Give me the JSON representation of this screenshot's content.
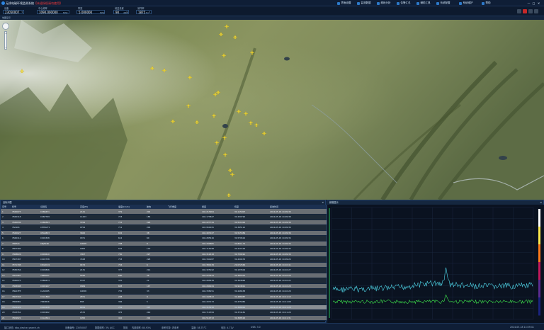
{
  "app": {
    "title": "无线电磁环境监测系统",
    "title_warn": "【未经授权请勿使用】",
    "menu": [
      {
        "label": "界面设置",
        "icon": "layout-icon"
      },
      {
        "label": "监测数据",
        "icon": "data-icon"
      },
      {
        "label": "频段分析",
        "icon": "analysis-icon"
      },
      {
        "label": "告警汇总",
        "icon": "alarm-icon"
      },
      {
        "label": "辅助工具",
        "icon": "tool-icon"
      },
      {
        "label": "系统配置",
        "icon": "config-icon"
      },
      {
        "label": "系统维护",
        "icon": "maintain-icon"
      },
      {
        "label": "帮助",
        "icon": "help-icon"
      }
    ],
    "window_controls": [
      "—",
      "□",
      "✕"
    ]
  },
  "params": [
    {
      "label": "设备",
      "value": "23050007",
      "unit": "",
      "dropdown": true
    },
    {
      "label": "中心频率",
      "value": "1090.000000",
      "unit": "MHz",
      "dropdown": false
    },
    {
      "label": "带宽",
      "value": "5.000000",
      "unit": "MHz",
      "dropdown": false
    },
    {
      "label": "增益设置",
      "value": "90",
      "unit": "dBm",
      "dropdown": true
    },
    {
      "label": "采样率",
      "value": "1875",
      "unit": "Hz",
      "dropdown": true
    }
  ],
  "toolbar_colors": [
    "#3a4a5e",
    "#c62828",
    "#3a4a5e",
    "#3a4a5e"
  ],
  "map": {
    "header": "地图显示",
    "zoom_in": "+",
    "zoom_out": "−",
    "aircraft": [
      [
        320,
        37
      ],
      [
        312,
        48
      ],
      [
        332,
        52
      ],
      [
        316,
        78
      ],
      [
        356,
        74
      ],
      [
        215,
        96
      ],
      [
        232,
        99
      ],
      [
        268,
        109
      ],
      [
        308,
        130
      ],
      [
        304,
        133
      ],
      [
        266,
        149
      ],
      [
        337,
        157
      ],
      [
        347,
        160
      ],
      [
        302,
        163
      ],
      [
        354,
        173
      ],
      [
        362,
        176
      ],
      [
        373,
        188
      ],
      [
        244,
        171
      ],
      [
        278,
        172
      ],
      [
        317,
        194
      ],
      [
        306,
        201
      ],
      [
        318,
        218
      ],
      [
        325,
        240
      ],
      [
        328,
        246
      ],
      [
        323,
        275
      ],
      [
        31,
        100
      ]
    ]
  },
  "list": {
    "header": "目标列表",
    "columns": [
      "序号",
      "呼号",
      "识别码",
      "高度(M)",
      "速度(km/h)",
      "航向",
      "飞行角度",
      "经度",
      "纬度",
      "接收时间"
    ],
    "rows": [
      [
        "1",
        "7840073",
        "CSN6471",
        "2141",
        "379",
        "202",
        "104.213904",
        "30.115007",
        "2024-05-18 14:09:39"
      ],
      [
        "2",
        "7840118",
        "CSN7799",
        "11203",
        "723",
        "186",
        "104.173847",
        "30.250792",
        "2024-05-18 14:09:38"
      ],
      [
        "3",
        "7840036",
        "CSN6303",
        "3764",
        "715",
        "228",
        "104.227744",
        "30.511024",
        "2024-05-18 14:09:38"
      ],
      [
        "4",
        "78A161",
        "CHH6271",
        "9754",
        "711",
        "204",
        "103.950015",
        "30.395112",
        "2024-05-18 14:09:36"
      ],
      [
        "5",
        "7840027",
        "UEA4803",
        "3462",
        "652",
        "38",
        "104.407227",
        "30.515389",
        "2024-05-18 14:09:36"
      ],
      [
        "6",
        "7840112",
        "CSC8328",
        "1871",
        "612",
        "60",
        "104.285416",
        "30.570614",
        "2024-05-18 14:09:34"
      ],
      [
        "7",
        "780E2C",
        "CBJ5148",
        "10008",
        "758",
        "8",
        "104.334805",
        "30.851174",
        "2024-05-18 14:09:34"
      ],
      [
        "8",
        "7807392",
        "",
        "1905",
        "522",
        "170",
        "104.715198",
        "30.211519",
        "2024-05-18 14:09:33"
      ],
      [
        "9",
        "780BB29",
        "CSC8610",
        "7007",
        "730",
        "227",
        "104.312418",
        "30.750491",
        "2024-05-18 14:09:30"
      ],
      [
        "10",
        "7807187",
        "CSC9738",
        "7428",
        "753",
        "228",
        "104.341287",
        "30.420476",
        "2024-05-18 14:09:24"
      ],
      [
        "11",
        "7871798",
        "CDG6101",
        "9474",
        "754",
        "6",
        "104.380139",
        "29.072566",
        "2024-05-18 14:10:41"
      ],
      [
        "12",
        "7830156",
        "CSC8846",
        "2131",
        "377",
        "214",
        "104.325192",
        "30.133504",
        "2024-05-18 14:10:27"
      ],
      [
        "13",
        "7807987",
        "784B007",
        "5496",
        "680",
        "36",
        "104.223424",
        "30.385502",
        "2024-05-18 14:10:26"
      ],
      [
        "14",
        "7840075",
        "CSN6473",
        "1317",
        "370",
        "22",
        "104.285439",
        "30.394848",
        "2024-05-18 14:10:22"
      ],
      [
        "15",
        "7808998",
        "CSC8107",
        "1869",
        "683",
        "147",
        "104.294224",
        "30.914811",
        "2024-05-18 14:10:29"
      ],
      [
        "16",
        "780A7FE",
        "CLA5085",
        "10058",
        "755",
        "33",
        "104.338151",
        "30.248438",
        "2024-05-18 14:10:29"
      ],
      [
        "17",
        "7807333",
        "CCA1890",
        "2871",
        "298",
        "9",
        "104.443813",
        "30.488087",
        "2024-05-18 14:11:13"
      ],
      [
        "18",
        "7806981",
        "7840B26",
        "838",
        "384",
        "5",
        "104.437173",
        "30.475982",
        "2024-05-18 14:11:08"
      ],
      [
        "19",
        "78A1422",
        "CSC8258",
        "6454",
        "701",
        "207",
        "104.313218",
        "31.368924",
        "2024-05-18 14:11:28"
      ],
      [
        "20",
        "7823352",
        "CSC8262",
        "2570",
        "475",
        "240",
        "104.711559",
        "30.374181",
        "2024-05-18 14:11:29"
      ],
      [
        "21",
        "7809822",
        "CCA4564",
        "1950",
        "410",
        "202",
        "104.510713",
        "30.398516",
        "2024-05-18 14:11:31"
      ]
    ]
  },
  "spectrum": {
    "header": "频谱显示",
    "colorbar": [
      "#ffffff",
      "#ffe94d",
      "#ff7a1a",
      "#c2185b",
      "#5b2c91",
      "#1a237e"
    ]
  },
  "status": {
    "items": [
      "接口状态: dbo_device_search.ch",
      "设备编号: 23050007",
      "数据频率: 3% AGC",
      "禁用",
      "内部频率: 80.93%",
      "参考时钟: 内参考",
      "温度: 58.75°C",
      "电压: 4.71V",
      "USB: 3.0",
      "2024-05-18 14:09:41"
    ]
  }
}
